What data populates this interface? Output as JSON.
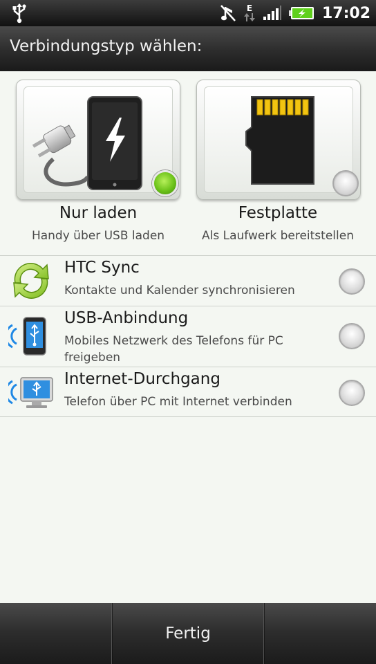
{
  "status_bar": {
    "time": "17:02",
    "network_type": "E",
    "icons": [
      "usb-icon",
      "mute-icon",
      "data-arrows-icon",
      "signal-icon",
      "battery-charging-icon"
    ],
    "battery_color": "#5fd01c"
  },
  "header": {
    "title": "Verbindungstyp wählen:"
  },
  "options_top": [
    {
      "label": "Nur laden",
      "sublabel": "Handy über USB laden",
      "icon": "phone-charger-icon",
      "selected": true
    },
    {
      "label": "Festplatte",
      "sublabel": "Als Laufwerk bereitstellen",
      "icon": "sd-card-icon",
      "selected": false
    }
  ],
  "options_list": [
    {
      "label": "HTC Sync",
      "sublabel": "Kontakte und Kalender synchronisieren",
      "icon": "sync-icon",
      "selected": false
    },
    {
      "label": "USB-Anbindung",
      "sublabel": "Mobiles Netzwerk des Telefons für PC freigeben",
      "icon": "usb-tethering-icon",
      "selected": false
    },
    {
      "label": "Internet-Durchgang",
      "sublabel": "Telefon über PC mit Internet verbinden",
      "icon": "internet-pass-through-icon",
      "selected": false
    }
  ],
  "footer": {
    "done_label": "Fertig"
  },
  "colors": {
    "selected_radio": "#6cc21a",
    "accent_blue": "#1e88e5",
    "background": "#f4f7f2"
  }
}
